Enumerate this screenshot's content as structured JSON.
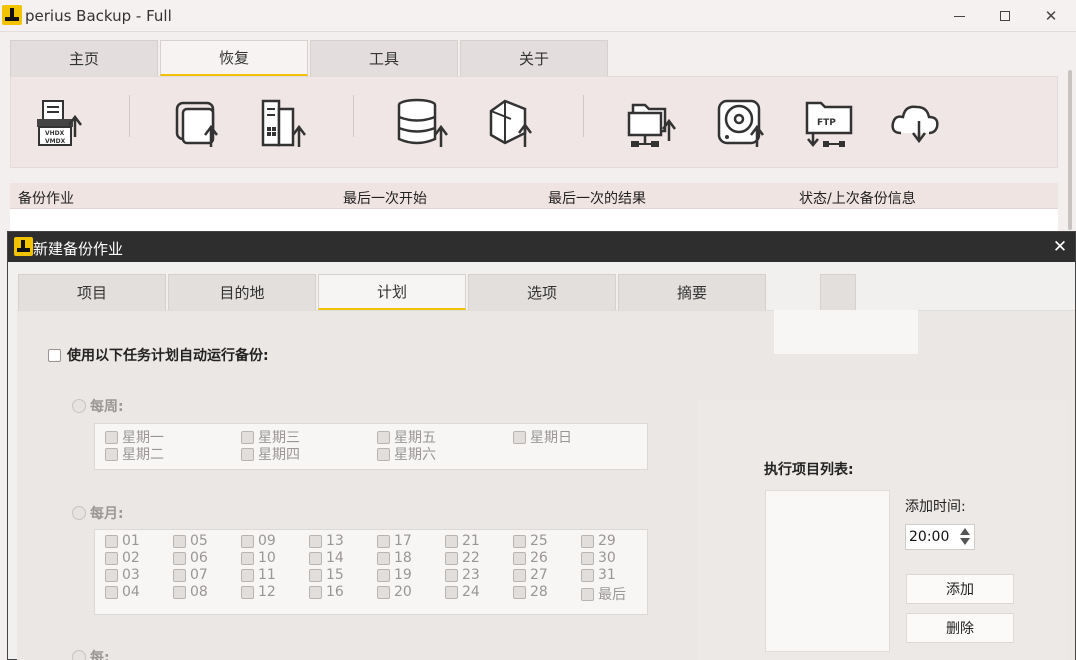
{
  "app": {
    "title": "perius Backup - Full",
    "tabs": [
      "主页",
      "恢复",
      "工具",
      "关于"
    ],
    "active_tab": 1
  },
  "toolbar": {
    "icons": [
      "vhdx-vmdx-backup-icon",
      "drive-image-backup-icon",
      "windows-server-backup-icon",
      "database-backup-icon",
      "office365-backup-icon",
      "network-share-backup-icon",
      "disk-backup-icon",
      "ftp-folder-icon",
      "cloud-restore-icon"
    ]
  },
  "job_table": {
    "columns": [
      "备份作业",
      "最后一次开始",
      "最后一次的结果",
      "状态/上次备份信息"
    ]
  },
  "dialog": {
    "title": "新建备份作业",
    "close": "✕",
    "tabs": [
      "项目",
      "目的地",
      "计划",
      "选项",
      "摘要"
    ],
    "active_tab": 2,
    "auto_run_label": "使用以下任务计划自动运行备份:",
    "weekly_label": "每周:",
    "weekdays": [
      "星期一",
      "星期二",
      "星期三",
      "星期四",
      "星期五",
      "星期六",
      "星期日"
    ],
    "monthly_label": "每月:",
    "month_days": [
      "01",
      "02",
      "03",
      "04",
      "05",
      "06",
      "07",
      "08",
      "09",
      "10",
      "11",
      "12",
      "13",
      "14",
      "15",
      "16",
      "17",
      "18",
      "19",
      "20",
      "21",
      "22",
      "23",
      "24",
      "25",
      "26",
      "27",
      "28",
      "29",
      "30",
      "31",
      "最后"
    ],
    "every_label": "每:",
    "exec_list_label": "执行项目列表:",
    "add_time_label": "添加时间:",
    "time_value": "20:00",
    "add_button": "添加",
    "delete_button": "删除"
  }
}
